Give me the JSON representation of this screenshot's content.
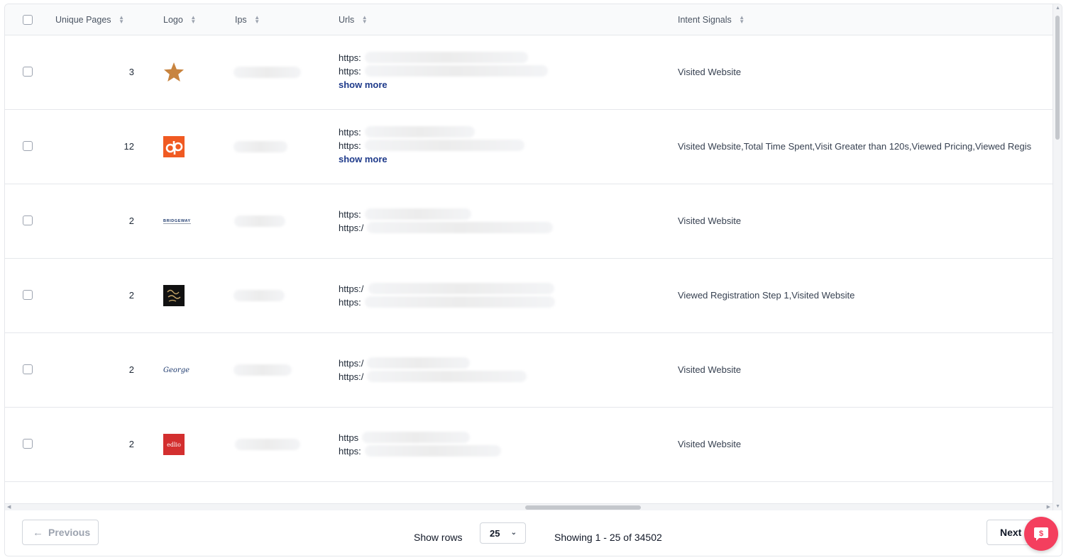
{
  "table": {
    "columns": [
      {
        "label": "Unique Pages"
      },
      {
        "label": "Logo"
      },
      {
        "label": "Ips"
      },
      {
        "label": "Urls"
      },
      {
        "label": "Intent Signals"
      }
    ],
    "rows": [
      {
        "unique_pages": "3",
        "logo": "star-logo",
        "url_prefixes": [
          "https:",
          "https:"
        ],
        "show_more": "show more",
        "intent_signals": "Visited Website"
      },
      {
        "unique_pages": "12",
        "logo": "dp-logo",
        "url_prefixes": [
          "https:",
          "https:"
        ],
        "show_more": "show more",
        "intent_signals": "Visited Website,Total Time Spent,Visit Greater than 120s,Viewed Pricing,Viewed Regis"
      },
      {
        "unique_pages": "2",
        "logo": "bridgeway-logo",
        "logo_text": "BRIDGEWAY",
        "url_prefixes": [
          "https:",
          "https:/"
        ],
        "intent_signals": "Visited Website"
      },
      {
        "unique_pages": "2",
        "logo": "dark-script-logo",
        "url_prefixes": [
          "https:/",
          "https:"
        ],
        "intent_signals": "Viewed Registration Step 1,Visited Website"
      },
      {
        "unique_pages": "2",
        "logo": "george-logo",
        "logo_text": "George",
        "url_prefixes": [
          "https:/",
          "https:/"
        ],
        "intent_signals": "Visited Website"
      },
      {
        "unique_pages": "2",
        "logo": "edlio-logo",
        "logo_text": "edlio",
        "url_prefixes": [
          "https",
          "https:"
        ],
        "intent_signals": "Visited Website"
      }
    ]
  },
  "footer": {
    "previous_label": "Previous",
    "next_label": "Next",
    "show_rows_label": "Show rows",
    "rows_per_page": "25",
    "showing_text": "Showing 1 - 25 of 34502"
  },
  "colors": {
    "link": "#1e3a8a",
    "chat_button": "#f43f5e",
    "dp_logo": "#f05a22",
    "edlio_logo": "#d32f2f",
    "star_logo": "#c8843f"
  },
  "icons": [
    "sort-icon",
    "arrow-left-icon",
    "chevron-down-icon",
    "chat-icon"
  ]
}
